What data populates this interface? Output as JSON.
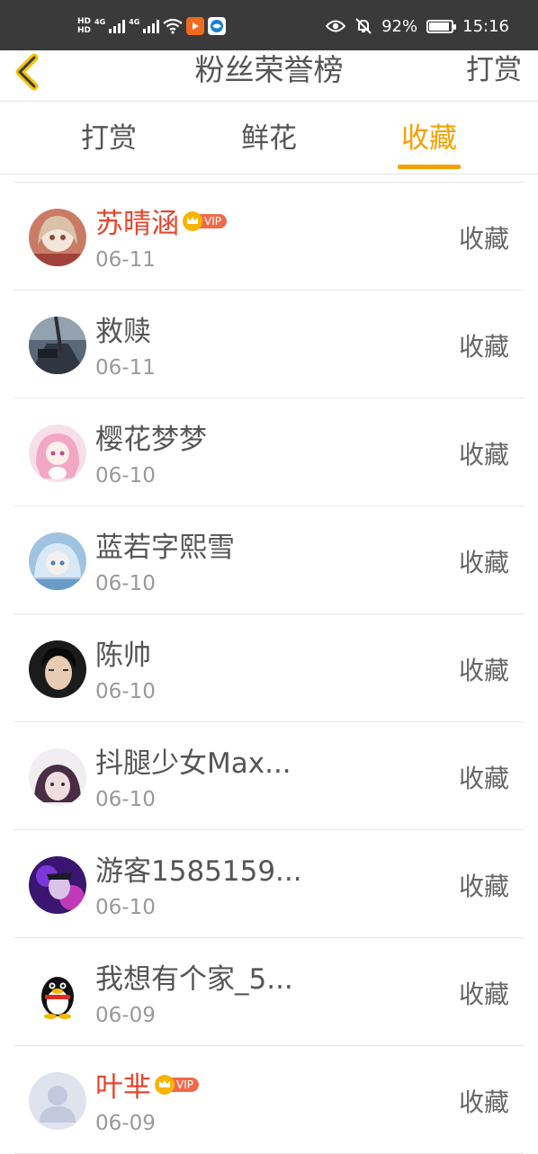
{
  "status_bar": {
    "hd1": "HD",
    "hd2": "HD",
    "net1": "4G",
    "net2": "4G",
    "battery_percent": "92%",
    "battery_level": 0.92,
    "time": "15:16"
  },
  "header": {
    "title": "粉丝荣誉榜",
    "right_link": "打赏"
  },
  "tabs": [
    {
      "label": "打赏",
      "active": false
    },
    {
      "label": "鲜花",
      "active": false
    },
    {
      "label": "收藏",
      "active": true
    }
  ],
  "colors": {
    "accent": "#f5a000",
    "vip_name": "#e8442b",
    "status_bar": "#3a3a3a"
  },
  "vip_label": "VIP",
  "fans": [
    {
      "name": "苏晴涵",
      "date": "06-11",
      "action": "收藏",
      "vip": true,
      "avatar": "anime-girl-avatar"
    },
    {
      "name": "救赎",
      "date": "06-11",
      "action": "收藏",
      "vip": false,
      "avatar": "street-photo-avatar"
    },
    {
      "name": "樱花梦梦",
      "date": "06-10",
      "action": "收藏",
      "vip": false,
      "avatar": "pink-anime-avatar"
    },
    {
      "name": "蓝若字熙雪",
      "date": "06-10",
      "action": "收藏",
      "vip": false,
      "avatar": "blue-anime-avatar"
    },
    {
      "name": "陈帅",
      "date": "06-10",
      "action": "收藏",
      "vip": false,
      "avatar": "boy-photo-avatar"
    },
    {
      "name": "抖腿少女Max...",
      "date": "06-10",
      "action": "收藏",
      "vip": false,
      "avatar": "girl-photo-avatar"
    },
    {
      "name": "游客1585159...",
      "date": "06-10",
      "action": "收藏",
      "vip": false,
      "avatar": "purple-photo-avatar"
    },
    {
      "name": "我想有个家_5...",
      "date": "06-09",
      "action": "收藏",
      "vip": false,
      "avatar": "qq-penguin-avatar"
    },
    {
      "name": "叶芈",
      "date": "06-09",
      "action": "收藏",
      "vip": true,
      "avatar": "default-user-avatar"
    }
  ]
}
